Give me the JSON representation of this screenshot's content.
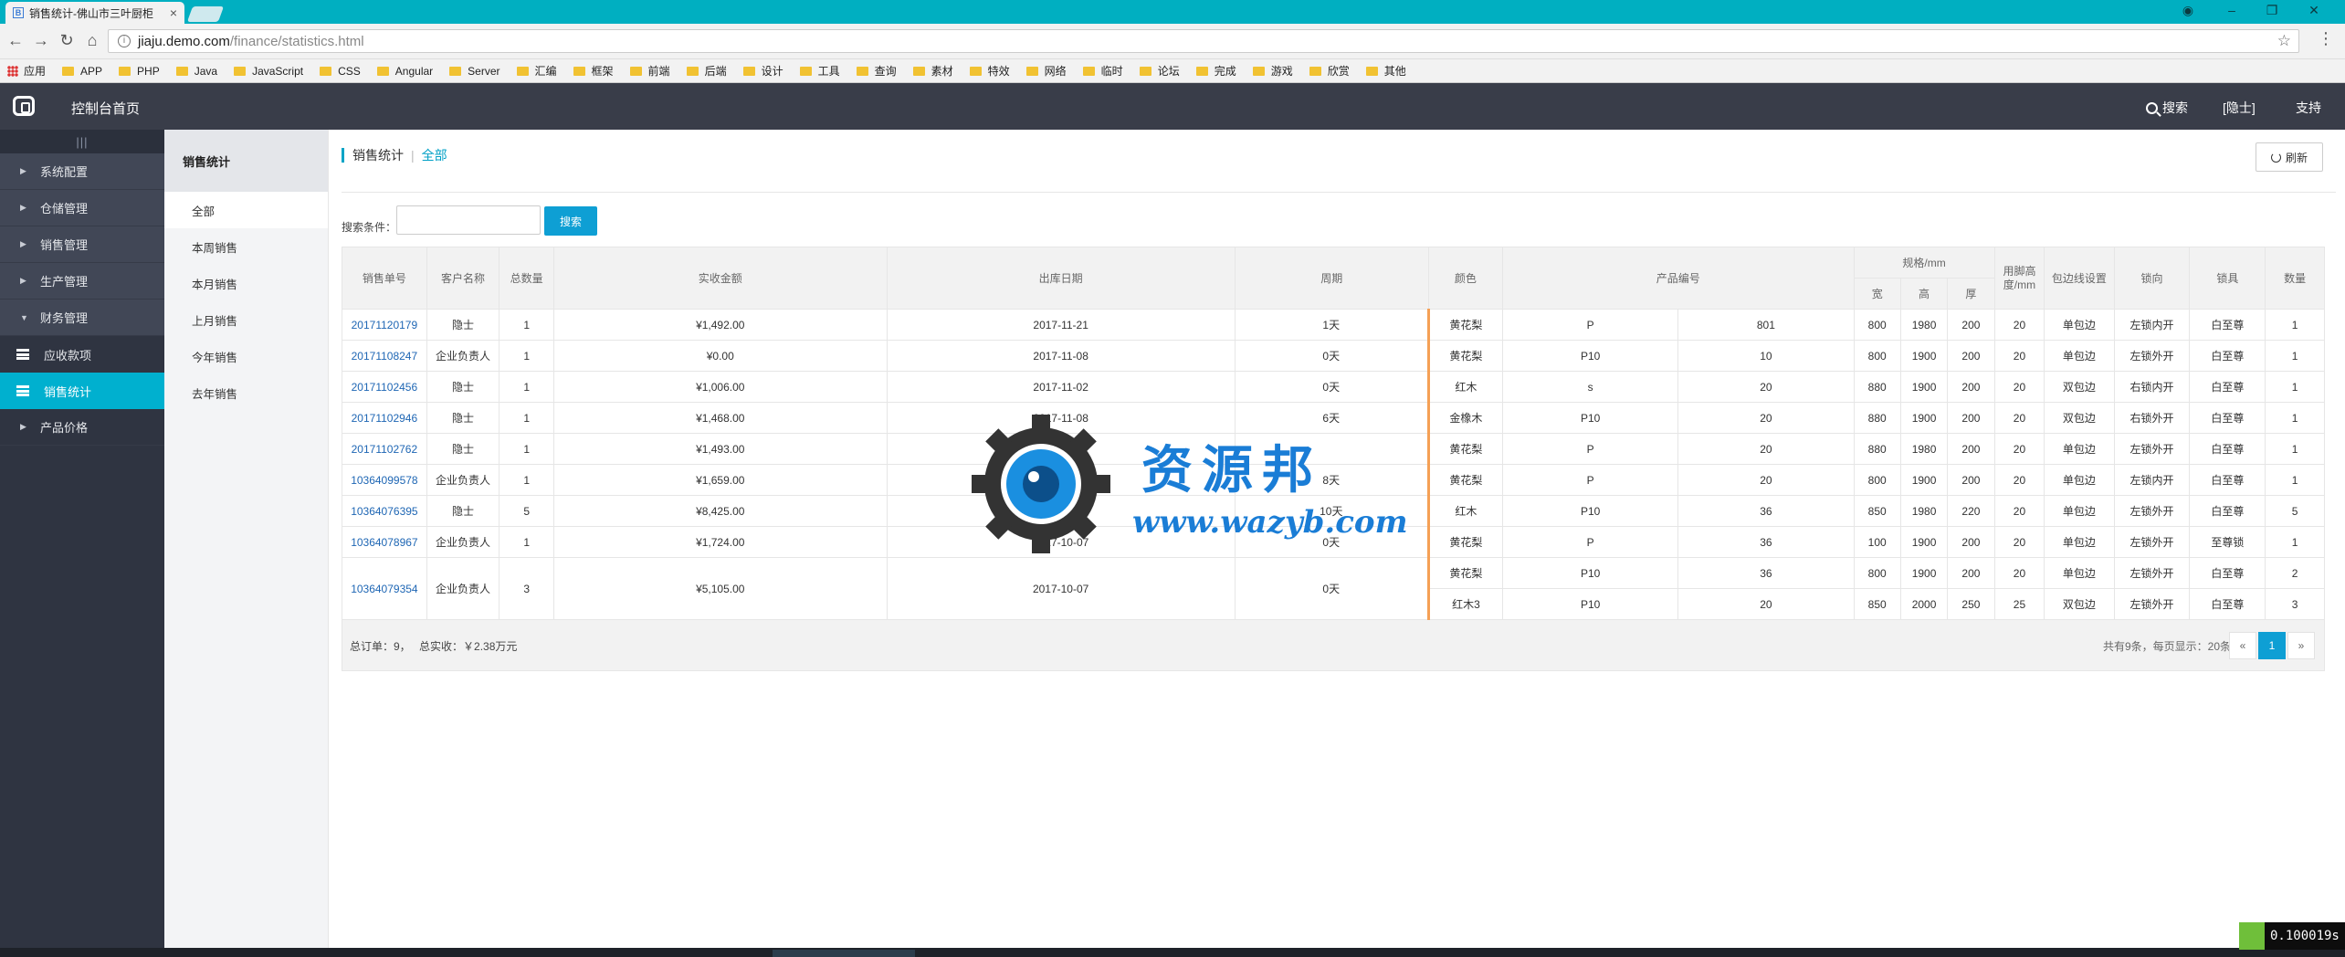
{
  "browser": {
    "tab_title": "销售统计-佛山市三叶厨柜",
    "tab_favicon": "B",
    "url_domain": "jiaju.demo.com",
    "url_path": "/finance/statistics.html",
    "bookmarks": [
      "应用",
      "APP",
      "PHP",
      "Java",
      "JavaScript",
      "CSS",
      "Angular",
      "Server",
      "汇编",
      "框架",
      "前端",
      "后端",
      "设计",
      "工具",
      "查询",
      "素材",
      "特效",
      "网络",
      "临时",
      "论坛",
      "完成",
      "游戏",
      "欣赏",
      "其他"
    ]
  },
  "topbar": {
    "home": "控制台首页",
    "search": "搜索",
    "user": "[隐士]",
    "support": "支持"
  },
  "sidebar": {
    "toggle": "|||",
    "items": [
      {
        "label": "系统配置"
      },
      {
        "label": "仓储管理"
      },
      {
        "label": "销售管理"
      },
      {
        "label": "生产管理"
      },
      {
        "label": "财务管理"
      }
    ],
    "sub_items": [
      {
        "label": "应收款项"
      },
      {
        "label": "销售统计"
      }
    ],
    "last_item": "产品价格"
  },
  "subnav": {
    "title": "销售统计",
    "items": [
      "全部",
      "本周销售",
      "本月销售",
      "上月销售",
      "今年销售",
      "去年销售"
    ]
  },
  "main": {
    "breadcrumb": [
      "销售统计",
      "全部"
    ],
    "refresh": "刷新",
    "filter_label": "搜索条件：",
    "filter_value": "",
    "filter_button": "搜索"
  },
  "table": {
    "headers": {
      "order_no": "销售单号",
      "customer": "客户名称",
      "total_qty": "总数量",
      "amount": "实收金额",
      "date": "出库日期",
      "cycle": "周期",
      "color": "颜色",
      "product_code": "产品编号",
      "spec": "规格/mm",
      "spec_w": "宽",
      "spec_h": "高",
      "spec_d": "厚",
      "edge_height": "用脚高度/mm",
      "edging": "包边线设置",
      "lock_dir": "锁向",
      "lock": "锁具",
      "qty": "数量"
    },
    "orders": [
      {
        "order_no": "20171120179",
        "customer": "隐士",
        "total_qty": "1",
        "amount": "¥1,492.00",
        "date": "2017-11-21",
        "cycle": "1天",
        "items": [
          {
            "color": "黄花梨",
            "code": "P",
            "code2": "801",
            "w": "800",
            "h": "1980",
            "d": "200",
            "edge": "20",
            "edging": "单包边",
            "lock_dir": "左锁内开",
            "lock": "白至尊",
            "qty": "1"
          }
        ]
      },
      {
        "order_no": "20171108247",
        "customer": "企业负责人",
        "total_qty": "1",
        "amount": "¥0.00",
        "date": "2017-11-08",
        "cycle": "0天",
        "items": [
          {
            "color": "黄花梨",
            "code": "P10",
            "code2": "10",
            "w": "800",
            "h": "1900",
            "d": "200",
            "edge": "20",
            "edging": "单包边",
            "lock_dir": "左锁外开",
            "lock": "白至尊",
            "qty": "1"
          }
        ]
      },
      {
        "order_no": "20171102456",
        "customer": "隐士",
        "total_qty": "1",
        "amount": "¥1,006.00",
        "date": "2017-11-02",
        "cycle": "0天",
        "items": [
          {
            "color": "红木",
            "code": "s",
            "code2": "20",
            "w": "880",
            "h": "1900",
            "d": "200",
            "edge": "20",
            "edging": "双包边",
            "lock_dir": "右锁内开",
            "lock": "白至尊",
            "qty": "1"
          }
        ]
      },
      {
        "order_no": "20171102946",
        "customer": "隐士",
        "total_qty": "1",
        "amount": "¥1,468.00",
        "date": "2017-11-08",
        "cycle": "6天",
        "items": [
          {
            "color": "金橡木",
            "code": "P10",
            "code2": "20",
            "w": "880",
            "h": "1900",
            "d": "200",
            "edge": "20",
            "edging": "双包边",
            "lock_dir": "右锁外开",
            "lock": "白至尊",
            "qty": "1"
          }
        ]
      },
      {
        "order_no": "20171102762",
        "customer": "隐士",
        "total_qty": "1",
        "amount": "¥1,493.00",
        "date": "",
        "cycle": "",
        "items": [
          {
            "color": "黄花梨",
            "code": "P",
            "code2": "20",
            "w": "880",
            "h": "1980",
            "d": "200",
            "edge": "20",
            "edging": "单包边",
            "lock_dir": "左锁外开",
            "lock": "白至尊",
            "qty": "1"
          }
        ]
      },
      {
        "order_no": "10364099578",
        "customer": "企业负责人",
        "total_qty": "1",
        "amount": "¥1,659.00",
        "date": "",
        "cycle": "8天",
        "items": [
          {
            "color": "黄花梨",
            "code": "P",
            "code2": "20",
            "w": "800",
            "h": "1900",
            "d": "200",
            "edge": "20",
            "edging": "单包边",
            "lock_dir": "左锁内开",
            "lock": "白至尊",
            "qty": "1"
          }
        ]
      },
      {
        "order_no": "10364076395",
        "customer": "隐士",
        "total_qty": "5",
        "amount": "¥8,425.00",
        "date": "2017-10-1",
        "cycle": "10天",
        "items": [
          {
            "color": "红木",
            "code": "P10",
            "code2": "36",
            "w": "850",
            "h": "1980",
            "d": "220",
            "edge": "20",
            "edging": "单包边",
            "lock_dir": "左锁外开",
            "lock": "白至尊",
            "qty": "5"
          }
        ]
      },
      {
        "order_no": "10364078967",
        "customer": "企业负责人",
        "total_qty": "1",
        "amount": "¥1,724.00",
        "date": "2017-10-07",
        "cycle": "0天",
        "items": [
          {
            "color": "黄花梨",
            "code": "P",
            "code2": "36",
            "w": "100",
            "h": "1900",
            "d": "200",
            "edge": "20",
            "edging": "单包边",
            "lock_dir": "左锁外开",
            "lock": "至尊锁",
            "qty": "1"
          }
        ]
      },
      {
        "order_no": "10364079354",
        "customer": "企业负责人",
        "total_qty": "3",
        "amount": "¥5,105.00",
        "date": "2017-10-07",
        "cycle": "0天",
        "items": [
          {
            "color": "黄花梨",
            "code": "P10",
            "code2": "36",
            "w": "800",
            "h": "1900",
            "d": "200",
            "edge": "20",
            "edging": "单包边",
            "lock_dir": "左锁外开",
            "lock": "白至尊",
            "qty": "2"
          },
          {
            "color": "红木3",
            "code": "P10",
            "code2": "20",
            "w": "850",
            "h": "2000",
            "d": "250",
            "edge": "25",
            "edging": "双包边",
            "lock_dir": "左锁外开",
            "lock": "白至尊",
            "qty": "3"
          }
        ]
      }
    ]
  },
  "footer": {
    "total_orders": "总订单：9，",
    "total_amount": "总实收：￥2.38万元",
    "pager_info": "共有9条，每页显示：20条",
    "prev": "«",
    "page": "1",
    "next": "»"
  },
  "watermark": {
    "title": "资源邦",
    "url": "www.wazyb.com"
  },
  "timer": "0.100019s",
  "colors": {
    "accent": "#00b0cf",
    "topbar": "#393d49",
    "sidebar": "#2f3441",
    "button": "#0e9fd4",
    "link": "#1e66b4"
  }
}
